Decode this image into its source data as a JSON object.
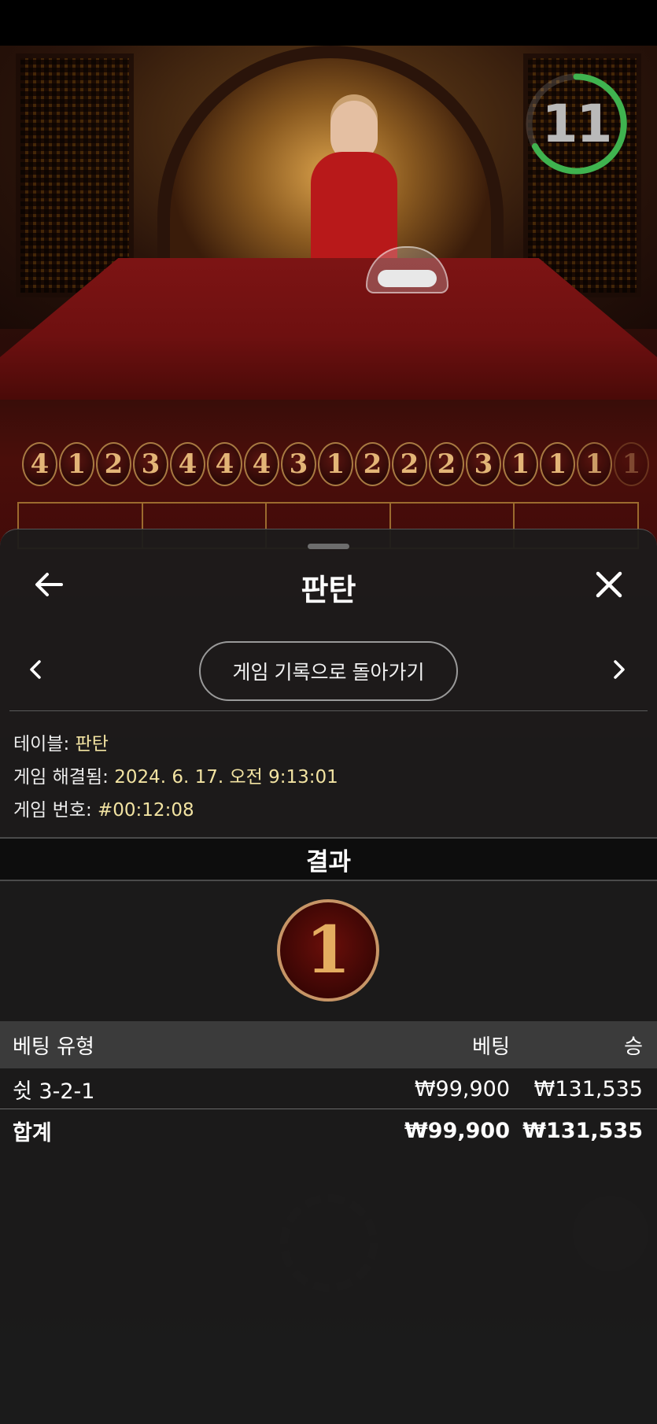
{
  "live": {
    "countdown": "11",
    "roads": [
      "4",
      "1",
      "2",
      "3",
      "4",
      "4",
      "4",
      "3",
      "1",
      "2",
      "2",
      "2",
      "3",
      "1",
      "1",
      "1",
      "1"
    ]
  },
  "sheet": {
    "title": "판탄",
    "nav": {
      "back_icon": "arrow-left-icon",
      "close_icon": "close-icon",
      "prev_icon": "chevron-left-icon",
      "next_icon": "chevron-right-icon",
      "back_to_history_label": "게임 기록으로 돌아가기"
    },
    "info": {
      "table_label": "테이블:",
      "table_value": "판탄",
      "resolved_label": "게임 해결됨:",
      "resolved_value": "2024. 6. 17. 오전 9:13:01",
      "game_no_label": "게임 번호:",
      "game_no_value": "#00:12:08"
    },
    "result": {
      "heading": "결과",
      "value": "1"
    },
    "table": {
      "headers": {
        "type": "베팅 유형",
        "bet": "베팅",
        "win": "승"
      },
      "rows": [
        {
          "type": "쉿 3-2-1",
          "bet": "₩99,900",
          "win": "₩131,535"
        }
      ],
      "total": {
        "type": "합계",
        "bet": "₩99,900",
        "win": "₩131,535"
      }
    }
  },
  "colors": {
    "accent_gold": "#e4ad60",
    "info_value": "#f2e3a2",
    "timer_ring": "#3fb34f"
  }
}
